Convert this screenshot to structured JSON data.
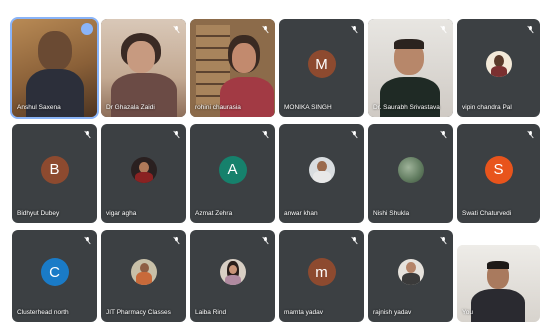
{
  "colors": {
    "tile_bg": "#3c4043",
    "highlight": "#8ab4f8"
  },
  "participants": [
    {
      "name": "Anshul Saxena",
      "type": "video",
      "icon": "pin-icon"
    },
    {
      "name": "Dr Ghazala Zaidi",
      "type": "video",
      "icon": "mic-off-icon"
    },
    {
      "name": "rohini chaurasia",
      "type": "video",
      "icon": "mic-off-icon"
    },
    {
      "name": "MONIKA SINGH",
      "type": "avatar",
      "letter": "M",
      "color": "#8d4a2f",
      "icon": "mic-off-icon"
    },
    {
      "name": "Dr. Saurabh Srivastava",
      "type": "photo",
      "icon": "mic-off-icon"
    },
    {
      "name": "vipin chandra Pal",
      "type": "photo",
      "icon": "mic-off-icon"
    },
    {
      "name": "Bidhyut Dubey",
      "type": "avatar",
      "letter": "B",
      "color": "#8d4a2f",
      "icon": "mic-off-icon"
    },
    {
      "name": "vigar agha",
      "type": "photo",
      "icon": "mic-off-icon"
    },
    {
      "name": "Azmat Zehra",
      "type": "avatar",
      "letter": "A",
      "color": "#16816c",
      "icon": "mic-off-icon"
    },
    {
      "name": "anwar khan",
      "type": "photo",
      "icon": "mic-off-icon"
    },
    {
      "name": "Nishi Shukla",
      "type": "photo",
      "icon": "mic-off-icon"
    },
    {
      "name": "Swati Chaturvedi",
      "type": "avatar",
      "letter": "S",
      "color": "#e8541c",
      "icon": "mic-off-icon"
    },
    {
      "name": "Clusterhead north",
      "type": "avatar",
      "letter": "C",
      "color": "#1a7bc7",
      "icon": "mic-off-icon"
    },
    {
      "name": "JIT Pharmacy Classes",
      "type": "photo",
      "icon": "mic-off-icon"
    },
    {
      "name": "Laiba Rind",
      "type": "photo",
      "icon": "mic-off-icon"
    },
    {
      "name": "mamta yadav",
      "type": "avatar",
      "letter": "m",
      "color": "#8d4a2f",
      "icon": "mic-off-icon"
    },
    {
      "name": "rajnish yadav",
      "type": "photo",
      "icon": "mic-off-icon"
    },
    {
      "name": "You",
      "type": "video",
      "icon": ""
    }
  ]
}
